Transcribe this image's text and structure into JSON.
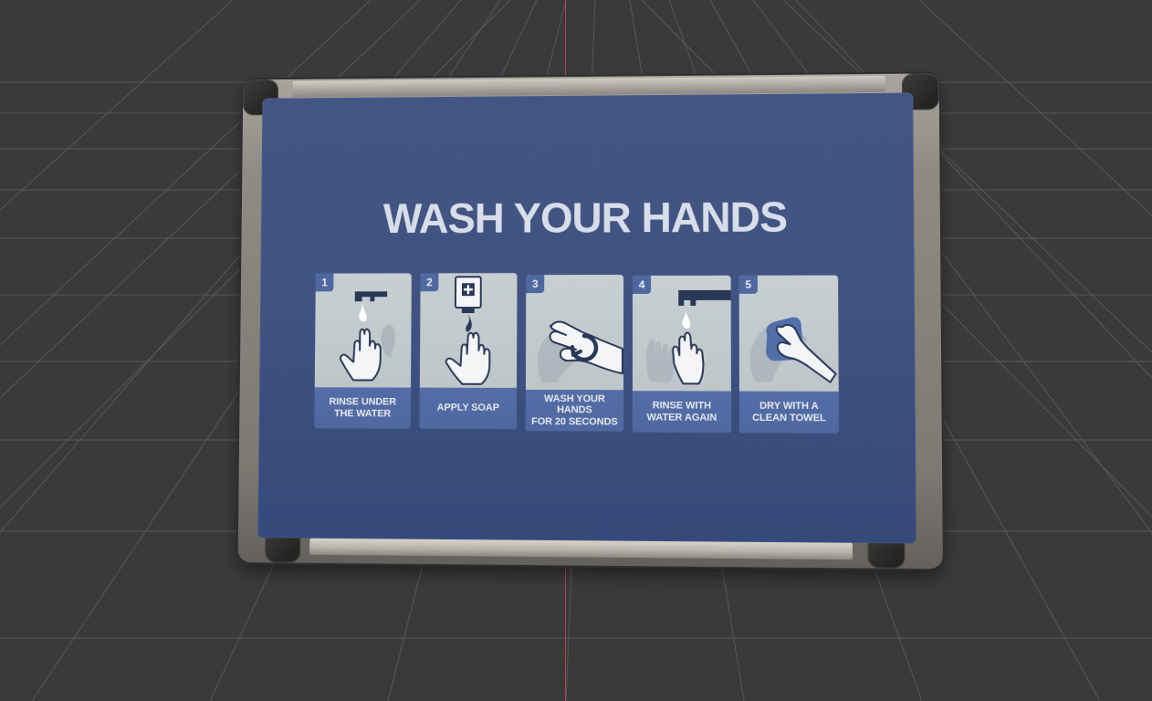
{
  "scene": {
    "title": "WASH YOUR HANDS",
    "steps": [
      {
        "number": "1",
        "label": "RINSE UNDER\nTHE WATER",
        "icon": "faucet-water-hand-icon"
      },
      {
        "number": "2",
        "label": "APPLY SOAP",
        "icon": "soap-dispenser-hand-icon"
      },
      {
        "number": "3",
        "label": "WASH YOUR HANDS\nFOR 20 SECONDS",
        "icon": "washing-hands-circular-arrow-icon"
      },
      {
        "number": "4",
        "label": "RINSE WITH\nWATER AGAIN",
        "icon": "faucet-rinse-hand-icon"
      },
      {
        "number": "5",
        "label": "DRY WITH A\nCLEAN TOWEL",
        "icon": "towel-drying-hand-icon"
      }
    ]
  },
  "colors": {
    "background": "#3a3a3a",
    "grid": "#5d5d5d",
    "axis": "#c14b57",
    "panel": "#3f5281",
    "title": "#d8ddea",
    "card_top": "#c3c9cd",
    "card_bottom": "#4f68a0"
  }
}
